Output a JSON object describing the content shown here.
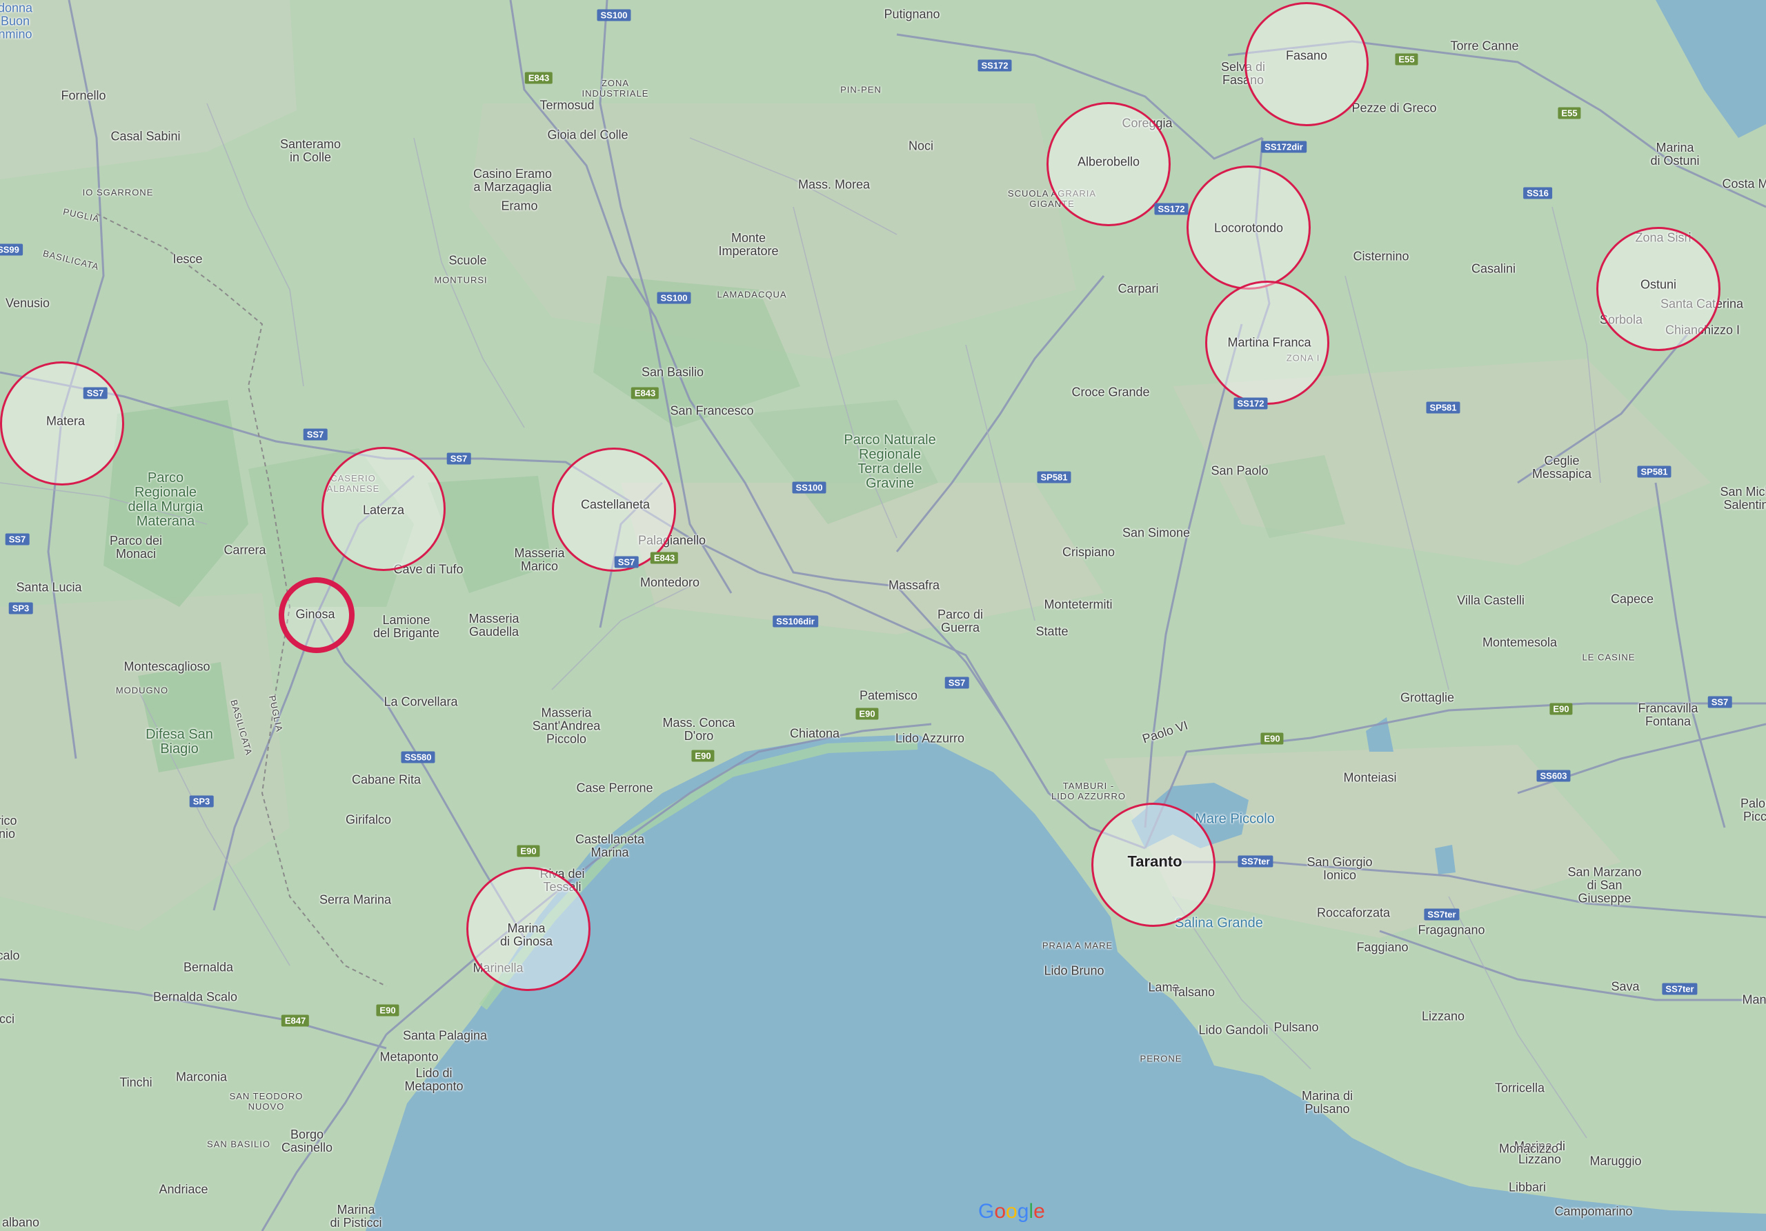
{
  "map": {
    "brand": "Google",
    "places": [
      {
        "label": "donna\nBuon\nnmino",
        "cls": "link"
      },
      {
        "label": "Fornello"
      },
      {
        "label": "Casal Sabini"
      },
      {
        "label": "IO SGARRONE",
        "cls": "small"
      },
      {
        "label": "PUGLIA",
        "cls": "small"
      },
      {
        "label": "BASILICATA",
        "cls": "small"
      },
      {
        "label": "Iesce"
      },
      {
        "label": "Venusio"
      },
      {
        "label": "Santeramo\nin Colle"
      },
      {
        "label": "Termosud"
      },
      {
        "label": "ZONA\nINDUSTRIALE",
        "cls": "small"
      },
      {
        "label": "Gioia del Colle"
      },
      {
        "label": "Casino Eramo\na Marzagaglia"
      },
      {
        "label": "Eramo"
      },
      {
        "label": "Scuole"
      },
      {
        "label": "MONTURSI",
        "cls": "small"
      },
      {
        "label": "Putignano"
      },
      {
        "label": "PIN-PEN",
        "cls": "small"
      },
      {
        "label": "Noci"
      },
      {
        "label": "Mass. Morea"
      },
      {
        "label": "Monte\nImperatore"
      },
      {
        "label": "LAMADACQUA",
        "cls": "small"
      },
      {
        "label": "Selva di\nFasano"
      },
      {
        "label": "Pezze di Greco"
      },
      {
        "label": "Torre Canne"
      },
      {
        "label": "Marina\ndi Ostuni"
      },
      {
        "label": "Costa M"
      },
      {
        "label": "Coreggia"
      },
      {
        "label": "SCUOLA AGRARIA\nGIGANTE",
        "cls": "small"
      },
      {
        "label": "Carpari"
      },
      {
        "label": "Cisternino"
      },
      {
        "label": "Casalini"
      },
      {
        "label": "Santa Caterina"
      },
      {
        "label": "Chianchizzo I"
      },
      {
        "label": "Sorbola"
      },
      {
        "label": "Zona Sisri"
      },
      {
        "label": "ZONA I",
        "cls": "small"
      },
      {
        "label": "San Basilio"
      },
      {
        "label": "San Francesco"
      },
      {
        "label": "Parco Naturale\nRegionale\nTerra delle\nGravine",
        "cls": "park"
      },
      {
        "label": "Croce Grande"
      },
      {
        "label": "San Paolo"
      },
      {
        "label": "Ceglie\nMessapica"
      },
      {
        "label": "San Mich\nSalentin"
      },
      {
        "label": "Parco\nRegionale\ndella Murgia\nMaterana",
        "cls": "park"
      },
      {
        "label": "Parco dei\nMonaci"
      },
      {
        "label": "Carrera"
      },
      {
        "label": "Santa Lucia"
      },
      {
        "label": "CASERIO\nALBANESE",
        "cls": "small"
      },
      {
        "label": "Cave di Tufo"
      },
      {
        "label": "Masseria\nMarico"
      },
      {
        "label": "Palagianello"
      },
      {
        "label": "Montedoro"
      },
      {
        "label": "Massafra"
      },
      {
        "label": "San Simone"
      },
      {
        "label": "Crispiano"
      },
      {
        "label": "Montetermiti"
      },
      {
        "label": "Statte"
      },
      {
        "label": "Parco di\nGuerra"
      },
      {
        "label": "Villa Castelli"
      },
      {
        "label": "Capece"
      },
      {
        "label": "Montemesola"
      },
      {
        "label": "LE CASINE",
        "cls": "small"
      },
      {
        "label": "Lamione\ndel Brigante"
      },
      {
        "label": "Masseria\nGaudella"
      },
      {
        "label": "Montescaglioso"
      },
      {
        "label": "MODUGNO",
        "cls": "small"
      },
      {
        "label": "BASILICATA",
        "cls": "small"
      },
      {
        "label": "PUGLIA",
        "cls": "small"
      },
      {
        "label": "La Corvellara"
      },
      {
        "label": "Masseria\nSant'Andrea\nPiccolo"
      },
      {
        "label": "Mass. Conca\nD'oro"
      },
      {
        "label": "Chiatona"
      },
      {
        "label": "Patemisco"
      },
      {
        "label": "Lido Azzurro"
      },
      {
        "label": "Grottaglie"
      },
      {
        "label": "Francavilla\nFontana"
      },
      {
        "label": "Difesa San\nBiagio",
        "cls": "park"
      },
      {
        "label": "Cabane Rita"
      },
      {
        "label": "Case Perrone"
      },
      {
        "label": "Paolo VI"
      },
      {
        "label": "TAMBURI -\nLIDO AZZURRO",
        "cls": "small"
      },
      {
        "label": "Monteiasi"
      },
      {
        "label": "Girifalco"
      },
      {
        "label": "Castellaneta\nMarina"
      },
      {
        "label": "Mare Piccolo",
        "cls": "water"
      },
      {
        "label": "San Giorgio\nIonico"
      },
      {
        "label": "San Marzano\ndi San\nGiuseppe"
      },
      {
        "label": "Palon\nPiccl"
      },
      {
        "label": "rico\nnio"
      },
      {
        "label": "Serra Marina"
      },
      {
        "label": "Riva dei\nTessali"
      },
      {
        "label": "Roccaforzata"
      },
      {
        "label": "Fragagnano"
      },
      {
        "label": "Salina Grande",
        "cls": "water"
      },
      {
        "label": "PRAIA A MARE",
        "cls": "small"
      },
      {
        "label": "Lido Bruno"
      },
      {
        "label": "Faggiano"
      },
      {
        "label": "calo"
      },
      {
        "label": "Bernalda"
      },
      {
        "label": "Bernalda Scalo"
      },
      {
        "label": "Marinella"
      },
      {
        "label": "Lama"
      },
      {
        "label": "Talsano"
      },
      {
        "label": "Sava"
      },
      {
        "label": "Mand"
      },
      {
        "label": "icci"
      },
      {
        "label": "Santa Palagina"
      },
      {
        "label": "Lido Gandoli"
      },
      {
        "label": "Pulsano"
      },
      {
        "label": "Lizzano"
      },
      {
        "label": "Metaponto"
      },
      {
        "label": "Lido di\nMetaponto"
      },
      {
        "label": "PERONE",
        "cls": "small"
      },
      {
        "label": "Tinchi"
      },
      {
        "label": "Marconia"
      },
      {
        "label": "SAN TEODORO\nNUOVO",
        "cls": "small"
      },
      {
        "label": "Marina di\nPulsano"
      },
      {
        "label": "Torricella"
      },
      {
        "label": "Borgo\nCasinello"
      },
      {
        "label": "SAN BASILIO",
        "cls": "small"
      },
      {
        "label": "Marina di\nLizzano"
      },
      {
        "label": "Monacizzo"
      },
      {
        "label": "Andriace"
      },
      {
        "label": "Maruggio"
      },
      {
        "label": "Libbari"
      },
      {
        "label": "Marina\ndi Pisticci"
      },
      {
        "label": "albano"
      },
      {
        "label": "Campomarino"
      }
    ],
    "rings": [
      {
        "label": "Fasano"
      },
      {
        "label": "Alberobello"
      },
      {
        "label": "Locorotondo"
      },
      {
        "label": "Ostuni"
      },
      {
        "label": "Martina Franca"
      },
      {
        "label": "Matera"
      },
      {
        "label": "Laterza"
      },
      {
        "label": "Castellaneta"
      },
      {
        "label": "Ginosa",
        "selected": true
      },
      {
        "label": "Taranto",
        "big": true
      },
      {
        "label": "Marina\ndi Ginosa"
      }
    ],
    "shields": [
      {
        "label": "SS100",
        "color": "blue"
      },
      {
        "label": "E843",
        "color": "green"
      },
      {
        "label": "SS172",
        "color": "blue"
      },
      {
        "label": "E55",
        "color": "green"
      },
      {
        "label": "E55",
        "color": "green"
      },
      {
        "label": "SS172dir",
        "color": "blue"
      },
      {
        "label": "SS172",
        "color": "blue"
      },
      {
        "label": "SS16",
        "color": "blue"
      },
      {
        "label": "SS99",
        "color": "blue"
      },
      {
        "label": "SS100",
        "color": "blue"
      },
      {
        "label": "E843",
        "color": "green"
      },
      {
        "label": "SS7",
        "color": "blue"
      },
      {
        "label": "SS7",
        "color": "blue"
      },
      {
        "label": "SS7",
        "color": "blue"
      },
      {
        "label": "SS172",
        "color": "blue"
      },
      {
        "label": "SP581",
        "color": "blue"
      },
      {
        "label": "SP581",
        "color": "blue"
      },
      {
        "label": "SS100",
        "color": "blue"
      },
      {
        "label": "SP581",
        "color": "blue"
      },
      {
        "label": "SS7",
        "color": "blue"
      },
      {
        "label": "SS7",
        "color": "blue"
      },
      {
        "label": "E843",
        "color": "green"
      },
      {
        "label": "SP3",
        "color": "blue"
      },
      {
        "label": "SS106dir",
        "color": "blue"
      },
      {
        "label": "SS7",
        "color": "blue"
      },
      {
        "label": "E90",
        "color": "green"
      },
      {
        "label": "E90",
        "color": "green"
      },
      {
        "label": "E90",
        "color": "green"
      },
      {
        "label": "SS7",
        "color": "blue"
      },
      {
        "label": "SS580",
        "color": "blue"
      },
      {
        "label": "E90",
        "color": "green"
      },
      {
        "label": "SS603",
        "color": "blue"
      },
      {
        "label": "SP3",
        "color": "blue"
      },
      {
        "label": "E90",
        "color": "green"
      },
      {
        "label": "SS7ter",
        "color": "blue"
      },
      {
        "label": "SS7ter",
        "color": "blue"
      },
      {
        "label": "E90",
        "color": "green"
      },
      {
        "label": "E847",
        "color": "green"
      },
      {
        "label": "SS7ter",
        "color": "blue"
      }
    ]
  }
}
